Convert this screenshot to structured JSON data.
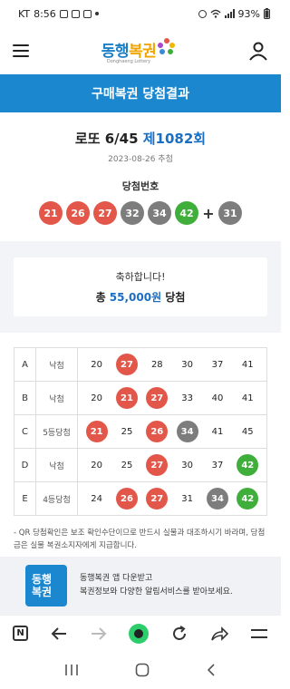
{
  "status": {
    "carrier": "KT",
    "time": "8:56",
    "battery": "93%"
  },
  "header": {
    "logo_text_1": "동행",
    "logo_text_2": "복권",
    "logo_sub": "Donghaeng Lottery"
  },
  "page_title": "구매복권 당첨결과",
  "draw": {
    "game": "로또 6/45",
    "round": "제1082회",
    "date": "2023-08-26 추첨",
    "label": "당첨번호",
    "numbers": [
      "21",
      "26",
      "27",
      "32",
      "34",
      "42"
    ],
    "plus": "+",
    "bonus": "31"
  },
  "congrats": {
    "line1": "축하합니다!",
    "prefix": "총",
    "amount": "55,000원",
    "suffix": "당첨"
  },
  "ticket": [
    {
      "game": "A",
      "result": "낙첨",
      "numbers": [
        "20",
        "27",
        "28",
        "30",
        "37",
        "41"
      ],
      "hits": [
        false,
        true,
        false,
        false,
        false,
        false
      ]
    },
    {
      "game": "B",
      "result": "낙첨",
      "numbers": [
        "20",
        "21",
        "27",
        "33",
        "40",
        "41"
      ],
      "hits": [
        false,
        true,
        true,
        false,
        false,
        false
      ]
    },
    {
      "game": "C",
      "result": "5등당첨",
      "numbers": [
        "21",
        "25",
        "26",
        "34",
        "41",
        "45"
      ],
      "hits": [
        true,
        false,
        true,
        true,
        false,
        false
      ]
    },
    {
      "game": "D",
      "result": "낙첨",
      "numbers": [
        "20",
        "25",
        "27",
        "30",
        "37",
        "42"
      ],
      "hits": [
        false,
        false,
        true,
        false,
        false,
        true
      ]
    },
    {
      "game": "E",
      "result": "4등당첨",
      "numbers": [
        "24",
        "26",
        "27",
        "31",
        "34",
        "42"
      ],
      "hits": [
        false,
        true,
        true,
        false,
        true,
        true
      ]
    }
  ],
  "notice": "- QR 당첨확인은 보조 확인수단이므로 반드시 실물과 대조하시기 바라며, 당첨금은 실물 복권소지자에게 지급합니다.",
  "app_banner": {
    "icon_line1": "동행",
    "icon_line2": "복권",
    "text1": "동행복권 앱 다운받고",
    "text2": "복권정보와 다양한 알림서비스를 받아보세요."
  },
  "browser": {
    "n_label": "N"
  },
  "colors": {
    "primary_blue": "#1a87cf",
    "red": "#e3574a",
    "gray": "#7d7d7d",
    "green": "#3fae3a"
  }
}
